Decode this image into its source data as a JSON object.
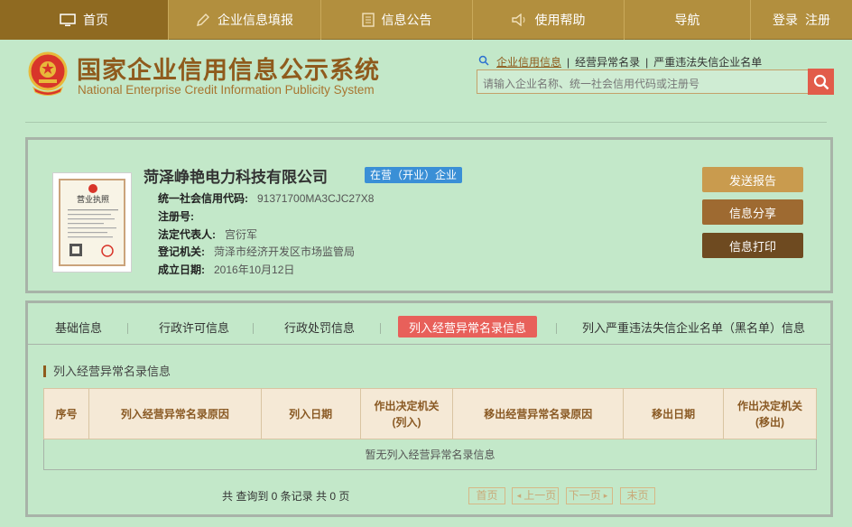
{
  "nav": {
    "home": "首页",
    "fill": "企业信息填报",
    "notice": "信息公告",
    "help": "使用帮助",
    "guide": "导航",
    "login": "登录",
    "register": "注册"
  },
  "header": {
    "title_cn": "国家企业信用信息公示系统",
    "title_en": "National Enterprise Credit Information Publicity System"
  },
  "search": {
    "links": [
      "企业信用信息",
      "经营异常名录",
      "严重违法失信企业名单"
    ],
    "separator": "|",
    "placeholder": "请输入企业名称、统一社会信用代码或注册号"
  },
  "license": {
    "title": "营业执照"
  },
  "company": {
    "name": "菏泽峥艳电力科技有限公司",
    "status": "在营（开业）企业",
    "fields": [
      {
        "label": "统一社会信用代码:",
        "value": "91371700MA3CJC27X8"
      },
      {
        "label": "注册号:",
        "value": ""
      },
      {
        "label": "法定代表人:",
        "value": "宫衍军"
      },
      {
        "label": "登记机关:",
        "value": "菏泽市经济开发区市场监管局"
      },
      {
        "label": "成立日期:",
        "value": "2016年10月12日"
      }
    ]
  },
  "actions": {
    "report": "发送报告",
    "share": "信息分享",
    "print": "信息打印"
  },
  "tabs": [
    "基础信息",
    "行政许可信息",
    "行政处罚信息",
    "列入经营异常名录信息",
    "列入严重违法失信企业名单（黑名单）信息"
  ],
  "active_tab_index": 3,
  "section": {
    "title": "列入经营异常名录信息"
  },
  "table": {
    "headers": [
      "序号",
      "列入经营异常名录原因",
      "列入日期",
      "作出决定机关\n(列入)",
      "移出经营异常名录原因",
      "移出日期",
      "作出决定机关\n(移出)"
    ],
    "empty_message": "暂无列入经营异常名录信息"
  },
  "pagination": {
    "summary": "共 查询到 0 条记录 共 0 页",
    "first": "首页",
    "prev": "上一页",
    "next": "下一页",
    "last": "末页"
  },
  "colors": {
    "nav_bg": "#b28f3e",
    "page_bg": "#c3e8c9",
    "title_brown": "#8f5b1d",
    "active_tab": "#e8605a",
    "badge_blue": "#3a8fd6",
    "search_btn": "#e25c4a"
  }
}
